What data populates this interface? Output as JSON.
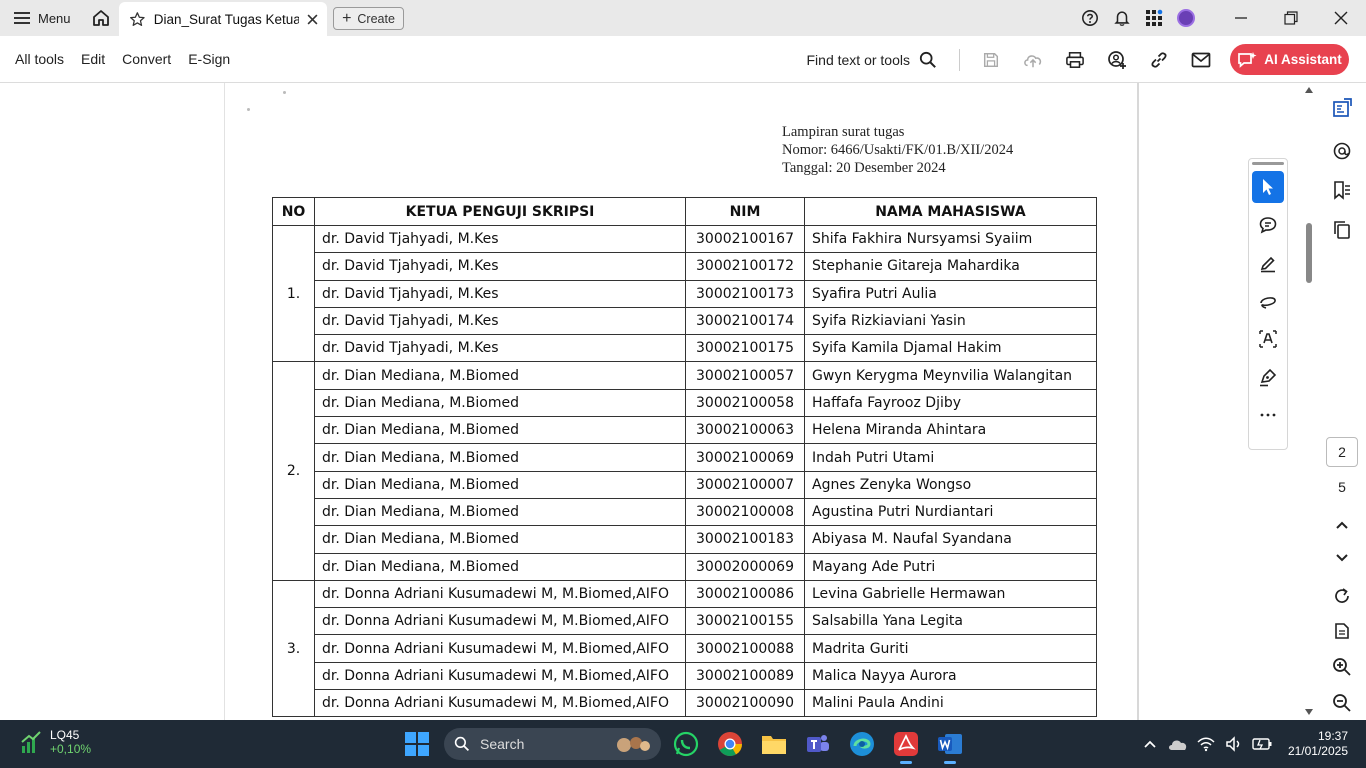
{
  "titlebar": {
    "menu_label": "Menu",
    "tab_title": "Dian_Surat Tugas Ketua ...",
    "create_label": "Create"
  },
  "toolbar": {
    "items": [
      "All tools",
      "Edit",
      "Convert",
      "E-Sign"
    ],
    "find_label": "Find text or tools",
    "ai_label": "AI Assistant"
  },
  "document": {
    "lampiran": [
      "Lampiran surat tugas",
      "Nomor:  6466/Usakti/FK/01.B/XII/2024",
      "Tanggal: 20 Desember 2024"
    ],
    "headers": [
      "NO",
      "KETUA PENGUJI SKRIPSI",
      "NIM",
      "NAMA MAHASISWA"
    ],
    "groups": [
      {
        "no": "1.",
        "rows": [
          [
            "dr. David Tjahyadi, M.Kes",
            "30002100167",
            "Shifa Fakhira Nursyamsi Syaiim"
          ],
          [
            "dr. David Tjahyadi, M.Kes",
            "30002100172",
            "Stephanie Gitareja Mahardika"
          ],
          [
            "dr. David Tjahyadi, M.Kes",
            "30002100173",
            "Syafira Putri Aulia"
          ],
          [
            "dr. David Tjahyadi, M.Kes",
            "30002100174",
            "Syifa Rizkiaviani Yasin"
          ],
          [
            "dr. David Tjahyadi, M.Kes",
            "30002100175",
            "Syifa Kamila Djamal Hakim"
          ]
        ]
      },
      {
        "no": "2.",
        "rows": [
          [
            "dr. Dian Mediana, M.Biomed",
            "30002100057",
            "Gwyn Kerygma Meynvilia Walangitan"
          ],
          [
            "dr. Dian Mediana, M.Biomed",
            "30002100058",
            "Haffafa Fayrooz Djiby"
          ],
          [
            "dr. Dian Mediana, M.Biomed",
            "30002100063",
            "Helena Miranda Ahintara"
          ],
          [
            "dr. Dian Mediana, M.Biomed",
            "30002100069",
            "Indah Putri Utami"
          ],
          [
            "dr. Dian Mediana, M.Biomed",
            "30002100007",
            "Agnes Zenyka Wongso"
          ],
          [
            "dr. Dian Mediana, M.Biomed",
            "30002100008",
            "Agustina Putri Nurdiantari"
          ],
          [
            "dr. Dian Mediana, M.Biomed",
            "30002100183",
            "Abiyasa M. Naufal Syandana"
          ],
          [
            "dr. Dian Mediana, M.Biomed",
            "30002000069",
            "Mayang Ade Putri"
          ]
        ]
      },
      {
        "no": "3.",
        "rows": [
          [
            "dr. Donna Adriani Kusumadewi M, M.Biomed,AIFO",
            "30002100086",
            "Levina Gabrielle Hermawan"
          ],
          [
            "dr. Donna Adriani Kusumadewi M, M.Biomed,AIFO",
            "30002100155",
            "Salsabilla Yana Legita"
          ],
          [
            "dr. Donna Adriani Kusumadewi M, M.Biomed,AIFO",
            "30002100088",
            "Madrita Guriti"
          ],
          [
            "dr. Donna Adriani Kusumadewi M, M.Biomed,AIFO",
            "30002100089",
            "Malica Nayya Aurora"
          ],
          [
            "dr. Donna Adriani Kusumadewi M, M.Biomed,AIFO",
            "30002100090",
            "Malini Paula Andini"
          ]
        ]
      }
    ]
  },
  "pager": {
    "current": "2",
    "total": "5"
  },
  "taskbar": {
    "widget_name": "LQ45",
    "widget_value": "+0,10%",
    "search_placeholder": "Search",
    "time": "19:37",
    "date": "21/01/2025"
  },
  "colors": {
    "accent": "#1473e6",
    "ai_button": "#e8424f",
    "taskbar": "#1f2a36"
  }
}
